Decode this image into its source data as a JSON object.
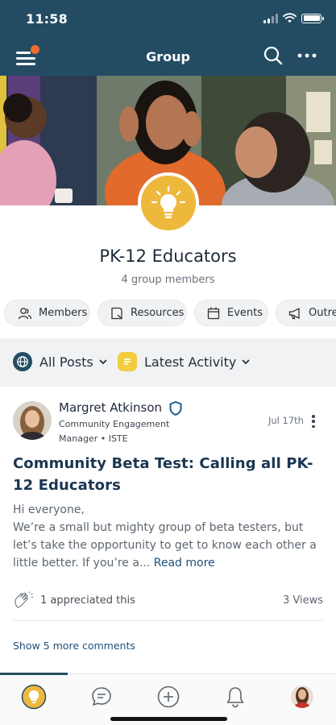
{
  "status_bar": {
    "time": "11:58"
  },
  "header": {
    "title": "Group",
    "menu_icon": "hamburger-menu-icon",
    "search_icon": "search-icon",
    "more_icon": "more-horizontal-icon",
    "background_color": "#234c63",
    "notification_dot_color": "#ef6b2c"
  },
  "group": {
    "name": "PK-12 Educators",
    "members": "4 group members",
    "badge_icon": "lightbulb-icon",
    "badge_color": "#eeb83d"
  },
  "tabs": [
    {
      "label": "Members",
      "icon": "members-icon"
    },
    {
      "label": "Resources",
      "icon": "resources-icon"
    },
    {
      "label": "Events",
      "icon": "calendar-icon"
    },
    {
      "label": "Outrea",
      "icon": "megaphone-icon"
    }
  ],
  "filters": {
    "posts": {
      "label": "All Posts",
      "icon": "globe-icon"
    },
    "sort": {
      "label": "Latest Activity",
      "icon": "activity-icon"
    }
  },
  "post": {
    "author": "Margret Atkinson",
    "role": "Community Engagement Manager • ISTE",
    "date": "Jul 17th",
    "title": "Community Beta Test: Calling all PK-12 Educators",
    "body_greeting": "Hi everyone,",
    "body_text": "We’re a small but mighty group of beta testers, but let’s take the opportunity to get to know each other a little better. If you’re a...",
    "read_more": "Read more",
    "appreciations": "1 appreciated this",
    "views": "3 Views",
    "more_comments": "Show 5 more comments"
  },
  "bottom_nav": [
    {
      "icon": "group-lightbulb-icon",
      "active": true
    },
    {
      "icon": "chat-icon",
      "active": false
    },
    {
      "icon": "add-icon",
      "active": false
    },
    {
      "icon": "bell-icon",
      "active": false
    },
    {
      "icon": "profile-avatar-icon",
      "active": false
    }
  ]
}
